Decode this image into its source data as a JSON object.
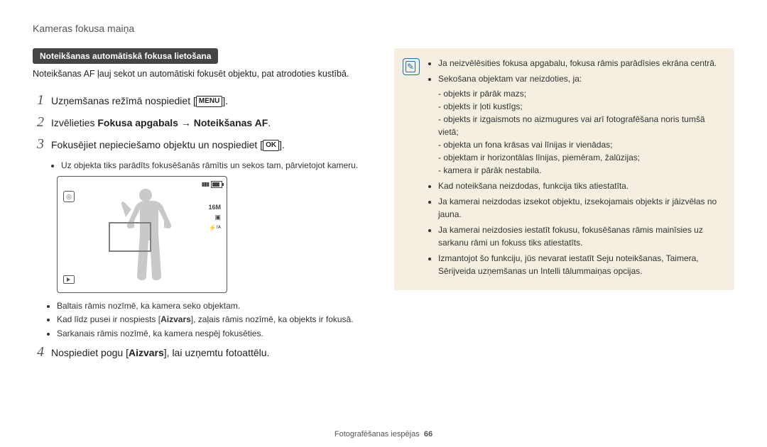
{
  "header": "Kameras fokusa maiņa",
  "section_title": "Noteikšanas automātiskā fokusa lietošana",
  "intro": "Noteikšanas AF ļauj sekot un automātiski fokusēt objektu, pat atrodoties kustībā.",
  "steps": {
    "s1": {
      "num": "1",
      "pre": "Uzņemšanas režīmā nospiediet [",
      "btn": "MENU",
      "post": "]."
    },
    "s2": {
      "num": "2",
      "pre": "Izvēlieties ",
      "b1": "Fokusa apgabals",
      "arrow": " → ",
      "b2": "Noteikšanas AF",
      "post": "."
    },
    "s3": {
      "num": "3",
      "pre": "Fokusējiet nepieciešamo objektu un nospiediet [",
      "btn": "OK",
      "post": "]."
    },
    "s4": {
      "num": "4",
      "pre": "Nospiediet pogu [",
      "b": "Aizvars",
      "post": "], lai uzņemtu fotoattēlu."
    }
  },
  "step3_sub": [
    "Uz objekta tiks parādīts fokusēšanās rāmītis un sekos tam, pārvietojot kameru."
  ],
  "illus": {
    "res": "16M",
    "meter": "▣",
    "flash": "ᶠᴬ"
  },
  "after_illus": [
    "Baltais rāmis nozīmē, ka kamera seko objektam.",
    "Kad līdz pusei ir nospiests [Aizvars], zaļais rāmis nozīmē, ka objekts ir fokusā.",
    "Sarkanais rāmis nozīmē, ka kamera nespēj fokusēties."
  ],
  "after_illus_bold_token": "Aizvars",
  "notes": {
    "n1": "Ja neizvēlēsities fokusa apgabalu, fokusa rāmis parādīsies ekrāna centrā.",
    "n2_lead": "Sekošana objektam var neizdoties, ja:",
    "n2_items": [
      "objekts ir pārāk mazs;",
      "objekts ir ļoti kustīgs;",
      "objekts ir izgaismots no aizmugures vai arī fotografēšana noris tumšā vietā;",
      "objekta un fona krāsas vai līnijas ir vienādas;",
      "objektam ir horizontālas līnijas, piemēram, žalūzijas;",
      "kamera ir pārāk nestabila."
    ],
    "n3": "Kad noteikšana neizdodas, funkcija tiks atiestatīta.",
    "n4": "Ja kamerai neizdodas izsekot objektu, izsekojamais objekts ir jāizvēlas no jauna.",
    "n5": "Ja kamerai neizdosies iestatīt fokusu, fokusēšanas rāmis mainīsies uz sarkanu rāmi un fokuss tiks atiestatīts.",
    "n6": "Izmantojot šo funkciju, jūs nevarat iestatīt Seju noteikšanas, Taimera, Sērijveida uzņemšanas un Intelli tālummaiņas opcijas."
  },
  "footer": {
    "label": "Fotografēšanas iespējas",
    "page": "66"
  }
}
